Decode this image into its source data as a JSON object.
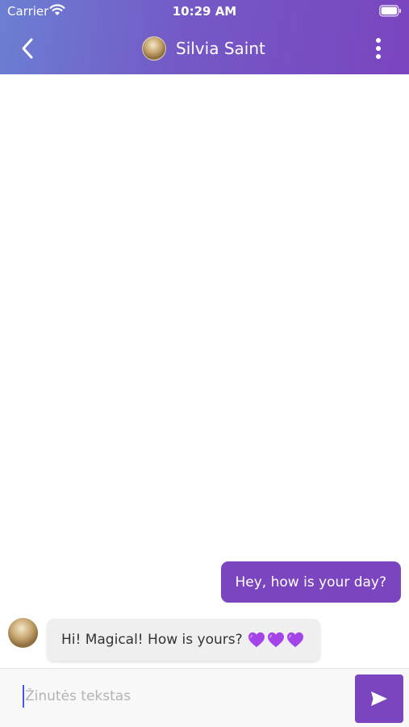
{
  "status_bar": {
    "carrier": "Carrier",
    "time": "10:29 AM",
    "icons": [
      "wifi-icon",
      "battery-icon"
    ]
  },
  "header": {
    "contact_name": "Silvia Saint",
    "icons": [
      "chevron-left-icon",
      "more-vertical-icon"
    ]
  },
  "messages": [
    {
      "direction": "outgoing",
      "text": "Hey, how is your day?"
    },
    {
      "direction": "incoming",
      "text": "Hi! Magical! How is yours?",
      "emoji": [
        "purple-heart",
        "purple-heart",
        "purple-heart"
      ]
    }
  ],
  "composer": {
    "placeholder": "Žinutės tekstas",
    "value": "",
    "icons": [
      "send-icon"
    ]
  },
  "colors": {
    "accent": "#7a45bf",
    "header_gradient_start": "#6b7fd3",
    "header_gradient_end": "#7a45bf",
    "incoming_bubble": "#efefef",
    "heart": "#a443e8"
  }
}
